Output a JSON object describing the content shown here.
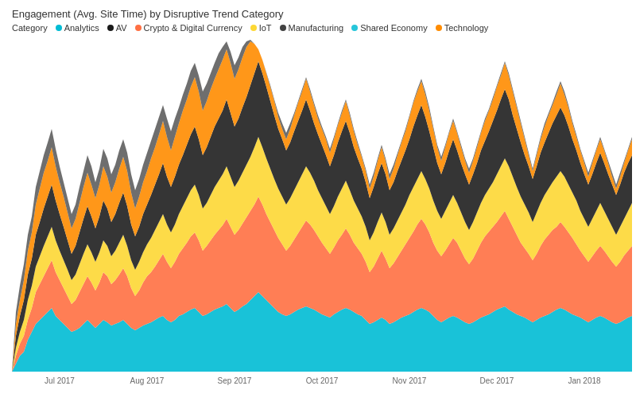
{
  "title": "Engagement (Avg. Site Time) by Disruptive Trend Category",
  "legend": {
    "category_label": "Category",
    "items": [
      {
        "name": "Analytics",
        "color": "#00BCD4"
      },
      {
        "name": "AV",
        "color": "#212121"
      },
      {
        "name": "Crypto & Digital Currency",
        "color": "#FF7043"
      },
      {
        "name": "IoT",
        "color": "#FDD835"
      },
      {
        "name": "Manufacturing",
        "color": "#424242"
      },
      {
        "name": "Shared Economy",
        "color": "#26C6DA"
      },
      {
        "name": "Technology",
        "color": "#FF8C00"
      }
    ]
  },
  "x_labels": [
    "Jul 2017",
    "Aug 2017",
    "Sep 2017",
    "Oct 2017",
    "Nov 2017",
    "Dec 2017",
    "Jan 2018"
  ],
  "colors": {
    "analytics": "#00BCD4",
    "av": "#1a1a1a",
    "crypto": "#FF7043",
    "iot": "#FDD835",
    "manufacturing": "#424242",
    "shared_economy": "#4DD0E1",
    "technology": "#FF8C00"
  }
}
